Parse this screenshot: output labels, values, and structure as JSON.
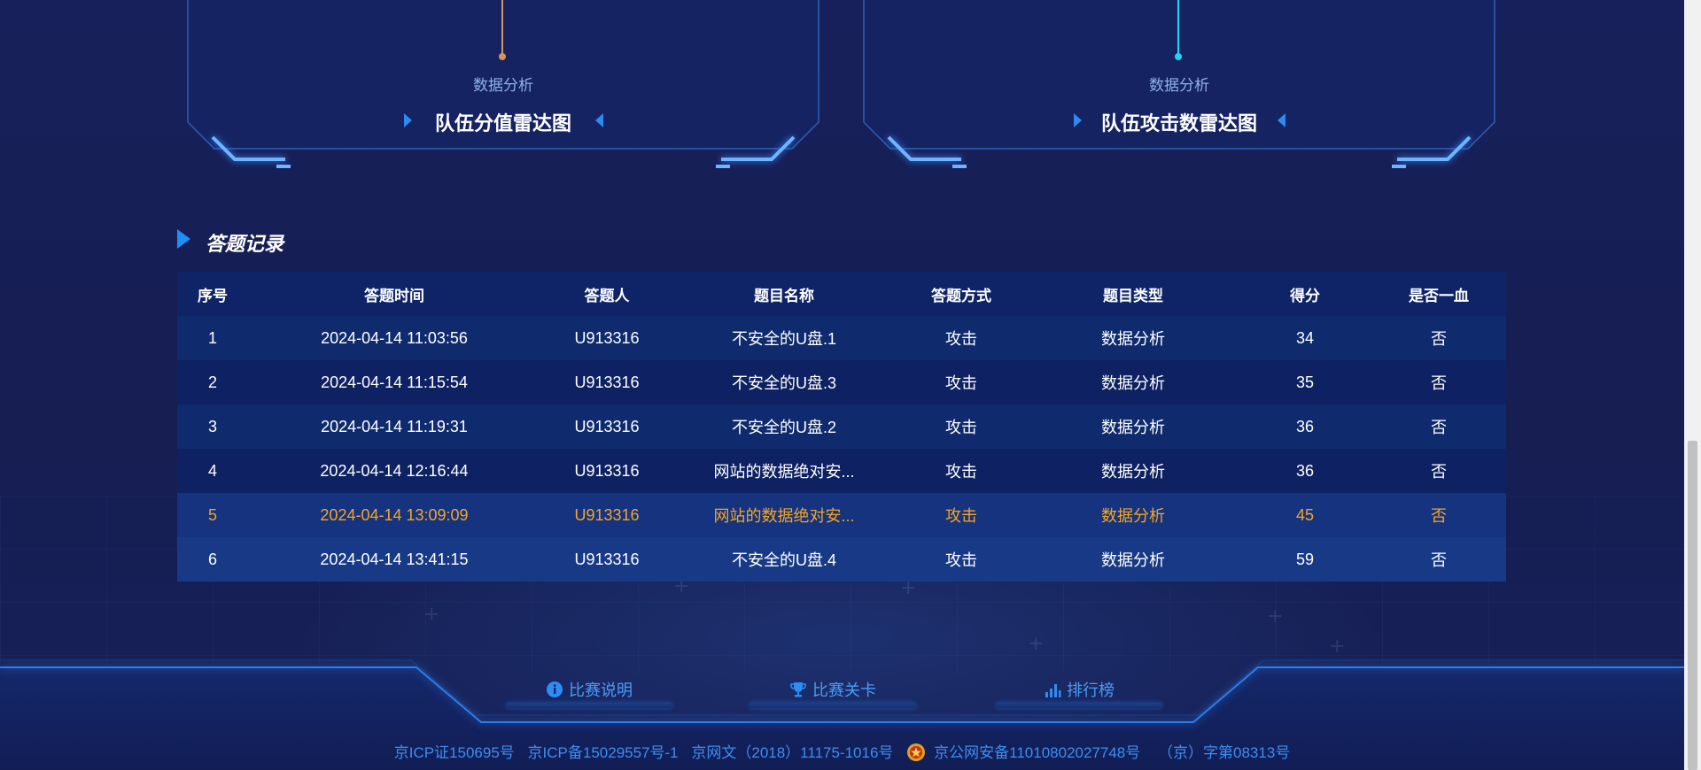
{
  "panels": [
    {
      "subtitle": "数据分析",
      "title": "队伍分值雷达图",
      "accent": "#d8935a"
    },
    {
      "subtitle": "数据分析",
      "title": "队伍攻击数雷达图",
      "accent": "#1ed6f0"
    }
  ],
  "section": {
    "title": "答题记录"
  },
  "table": {
    "headers": [
      "序号",
      "答题时间",
      "答题人",
      "题目名称",
      "答题方式",
      "题目类型",
      "得分",
      "是否一血"
    ],
    "rows": [
      [
        "1",
        "2024-04-14 11:03:56",
        "U913316",
        "不安全的U盘.1",
        "攻击",
        "数据分析",
        "34",
        "否"
      ],
      [
        "2",
        "2024-04-14 11:15:54",
        "U913316",
        "不安全的U盘.3",
        "攻击",
        "数据分析",
        "35",
        "否"
      ],
      [
        "3",
        "2024-04-14 11:19:31",
        "U913316",
        "不安全的U盘.2",
        "攻击",
        "数据分析",
        "36",
        "否"
      ],
      [
        "4",
        "2024-04-14 12:16:44",
        "U913316",
        "网站的数据绝对安...",
        "攻击",
        "数据分析",
        "36",
        "否"
      ],
      [
        "5",
        "2024-04-14 13:09:09",
        "U913316",
        "网站的数据绝对安...",
        "攻击",
        "数据分析",
        "45",
        "否"
      ],
      [
        "6",
        "2024-04-14 13:41:15",
        "U913316",
        "不安全的U盘.4",
        "攻击",
        "数据分析",
        "59",
        "否"
      ]
    ],
    "highlight_row_color": "#f5a623"
  },
  "footer": {
    "nav": [
      {
        "label": "比赛说明",
        "icon": "info-icon"
      },
      {
        "label": "比赛关卡",
        "icon": "trophy-icon"
      },
      {
        "label": "排行榜",
        "icon": "bar-chart-icon"
      }
    ],
    "icp": [
      "京ICP证150695号",
      "京ICP备15029557号-1",
      "京网文（2018）11175-1016号",
      "京公网安备11010802027748号",
      "（京）字第08313号"
    ],
    "police_icon": "police-badge-icon"
  }
}
